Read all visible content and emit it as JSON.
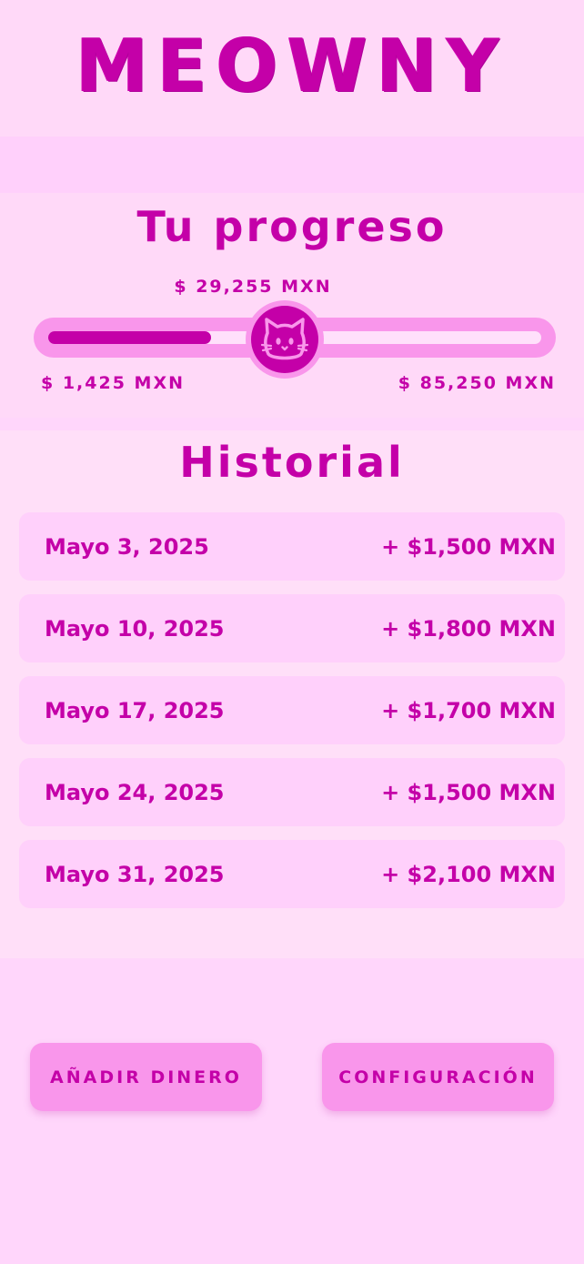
{
  "app": {
    "title": "MEOWNY"
  },
  "progress": {
    "title": "Tu progreso",
    "current_amount": "$ 29,255 MXN",
    "min_label": "$ 1,425 MXN",
    "max_label": "$ 85,250 MXN",
    "fraction": 0.33,
    "thumb_icon": "cat-face-icon"
  },
  "history": {
    "title": "Historial",
    "items": [
      {
        "date": "Mayo 3, 2025",
        "amount": "+ $1,500 MXN"
      },
      {
        "date": "Mayo 10, 2025",
        "amount": "+ $1,800 MXN"
      },
      {
        "date": "Mayo 17, 2025",
        "amount": "+ $1,700 MXN"
      },
      {
        "date": "Mayo 24, 2025",
        "amount": "+ $1,500 MXN"
      },
      {
        "date": "Mayo 31, 2025",
        "amount": "+ $2,100 MXN"
      }
    ]
  },
  "buttons": {
    "add_money": "AÑADIR DINERO",
    "settings": "CONFIGURACIÓN"
  },
  "colors": {
    "accent": "#c400a8",
    "track": "#f996eb",
    "background": "#ffd6fb"
  }
}
